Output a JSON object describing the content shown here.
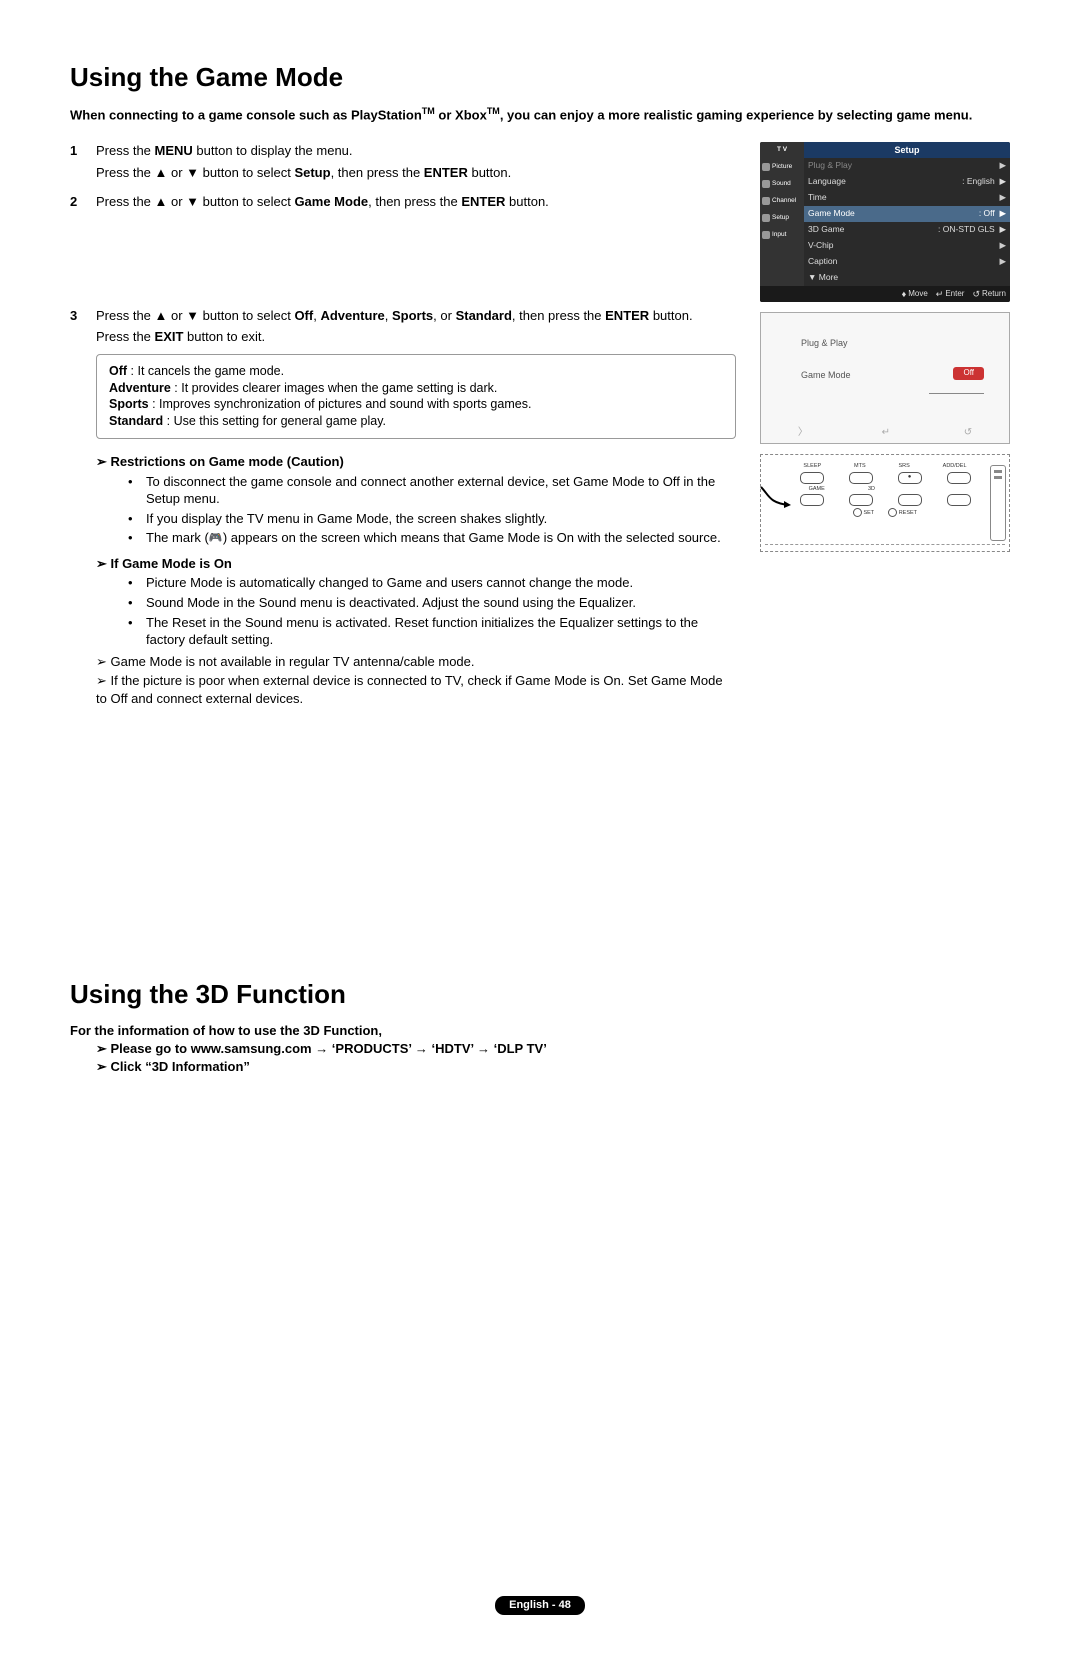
{
  "section1": {
    "title": "Using the Game Mode",
    "intro_pre": "When connecting to a game console such as PlayStation",
    "intro_mid": " or Xbox",
    "intro_post": ", you can enjoy a more realistic gaming experience by selecting game menu.",
    "tm": "TM",
    "step1_num": "1",
    "step1_a_pre": "Press the ",
    "step1_a_b1": "MENU",
    "step1_a_post": " button to display the menu.",
    "step1_b_pre": "Press the ▲ or ▼ button to select ",
    "step1_b_b1": "Setup",
    "step1_b_mid": ", then press the ",
    "step1_b_b2": "ENTER",
    "step1_b_post": " button.",
    "step2_num": "2",
    "step2_pre": "Press the ▲ or ▼ button to select ",
    "step2_b1": "Game Mode",
    "step2_mid": ", then press the ",
    "step2_b2": "ENTER",
    "step2_post": " button.",
    "step3_num": "3",
    "step3_a_pre": "Press the ▲ or ▼ button to select ",
    "step3_a_b1": "Off",
    "step3_a_s1": ", ",
    "step3_a_b2": "Adventure",
    "step3_a_s2": ", ",
    "step3_a_b3": "Sports",
    "step3_a_s3": ", or ",
    "step3_a_b4": "Standard",
    "step3_a_mid": ", then press the ",
    "step3_a_b5": "ENTER",
    "step3_a_post": " button.",
    "step3_b_pre": "Press the ",
    "step3_b_b1": "EXIT",
    "step3_b_post": " button to exit."
  },
  "inset": {
    "l1_b": "Off",
    "l1_t": " : It cancels the game mode.",
    "l2_b": "Adventure",
    "l2_t": " : It provides clearer images when the game setting is dark.",
    "l3_b": "Sports",
    "l3_t": " : Improves synchronization of pictures and sound with sports games.",
    "l4_b": "Standard",
    "l4_t": " : Use this setting for general game play."
  },
  "restrict": {
    "head": "Restrictions on Game mode (Caution)",
    "b1": "To disconnect the game console and connect another external device, set Game Mode to Off in the Setup menu.",
    "b2": "If you display the TV menu in Game Mode, the screen shakes slightly.",
    "b3_pre": "The mark (",
    "b3_post": ") appears on the screen which means that Game Mode is On with the selected source."
  },
  "ifon": {
    "head": "If Game Mode is On",
    "b1": "Picture Mode is automatically changed to Game and users cannot change the mode.",
    "b2": "Sound Mode in the Sound menu is deactivated. Adjust the sound using the Equalizer.",
    "b3": "The Reset in the Sound menu is activated. Reset function initializes the Equalizer settings to the factory default setting."
  },
  "notes": {
    "n1": "Game Mode is not available in regular TV antenna/cable mode.",
    "n2": "If the picture is poor when external device is connected to TV, check if Game Mode is On. Set Game Mode to Off and connect external devices."
  },
  "osd": {
    "tv": "T V",
    "title": "Setup",
    "tabs": {
      "picture": "Picture",
      "sound": "Sound",
      "channel": "Channel",
      "setup": "Setup",
      "input": "Input"
    },
    "rows": {
      "plugplay": "Plug & Play",
      "language": "Language",
      "language_v": ": English",
      "time": "Time",
      "gamemode": "Game Mode",
      "gamemode_v": ": Off",
      "game3d": "3D Game",
      "game3d_v": ": ON-STD GLS",
      "vchip": "V-Chip",
      "caption": "Caption",
      "more": "▼ More"
    },
    "foot": {
      "move": "Move",
      "enter": "Enter",
      "return": "Return"
    }
  },
  "osd2": {
    "r1": "Plug & Play",
    "r2": "Game Mode",
    "badge": "Off"
  },
  "remote": {
    "top": {
      "sleep": "SLEEP",
      "mts": "MTS",
      "srs": "SRS",
      "adddel": "ADD/DEL"
    },
    "mid": {
      "game": "GAME",
      "threeD": "3D"
    },
    "bot": {
      "set": "SET",
      "reset": "RESET"
    }
  },
  "section2": {
    "title": "Using the 3D Function",
    "intro": "For the information of how to use the 3D Function,",
    "l1": "Please go to www.samsung.com →  ‘PRODUCTS’ →  ‘HDTV’ → ‘DLP TV’",
    "l2": "Click “3D Information”"
  },
  "footer": "English - 48"
}
